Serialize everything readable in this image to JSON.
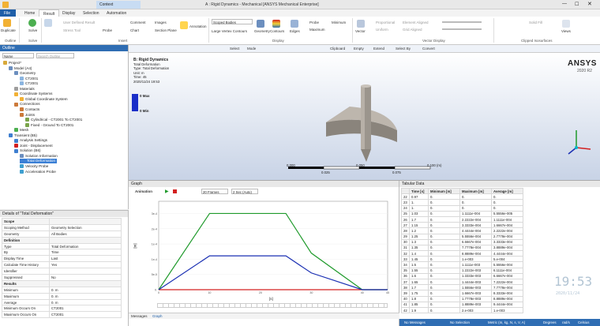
{
  "window": {
    "title": "A : Rigid Dynamics - Mechanical [ANSYS Mechanical Enterprise]",
    "context_tab": "Context"
  },
  "ribbon_tabs": [
    "File",
    "Home",
    "Result",
    "Display",
    "Selection",
    "Automation"
  ],
  "ribbon": {
    "duplicate": "Duplicate",
    "solve": "Solve",
    "solve_icon_label": "Solve",
    "user_defined_result": "User Defined Result",
    "stress_tool": "Stress Tool",
    "probe": "Probe",
    "comment": "Comment",
    "images": "Images",
    "chart": "Chart",
    "section_plane": "Section Plane",
    "annotation": "Annotation",
    "scoped_bodies": "Scoped Bodies",
    "large_vertex_contours": "Large Vertex Contours",
    "geometry": "Geometry",
    "contours": "Contours",
    "edges": "Edges",
    "probe_btn": "Probe",
    "maximum": "Maximum",
    "minimum": "Minimum",
    "vector": "Vector",
    "proportional": "Proportional",
    "uniform": "Uniform",
    "element_aligned": "Element Aligned",
    "grid_aligned": "Grid Aligned",
    "solid_fill": "Solid Fill",
    "views": "Views",
    "groups": [
      "Outline",
      "Solve",
      "Insert",
      "Display",
      "Vector Display",
      "Clipped Isosurfaces"
    ]
  },
  "outline": {
    "title": "Outline",
    "search_label": "Name",
    "search_placeholder": "Search Outline",
    "tree": [
      "Project*",
      "Model (A4)",
      "Geometry",
      "CT2001",
      "CT2001",
      "Materials",
      "Coordinate Systems",
      "Global Coordinate System",
      "Connections",
      "Contacts",
      "Joints",
      "Cylindrical - CT2001 To CT2001",
      "Fixed - Ground To CT2001",
      "Mesh",
      "Transient (B5)",
      "Analysis Settings",
      "Joint - Displacement",
      "Solution (B6)",
      "Solution Information",
      "Total Deformation",
      "Velocity Probe",
      "Acceleration Probe"
    ]
  },
  "details": {
    "title": "Details of \"Total Deformation\"",
    "rows": [
      {
        "k": "Scope",
        "v": "",
        "sec": true
      },
      {
        "k": "Scoping Method",
        "v": "Geometry Selection"
      },
      {
        "k": "Geometry",
        "v": "All Bodies"
      },
      {
        "k": "Definition",
        "v": "",
        "sec": true
      },
      {
        "k": "Type",
        "v": "Total Deformation"
      },
      {
        "k": "By",
        "v": "Time"
      },
      {
        "k": "Display Time",
        "v": "Last"
      },
      {
        "k": "Calculate Time History",
        "v": "Yes"
      },
      {
        "k": "Identifier",
        "v": ""
      },
      {
        "k": "Suppressed",
        "v": "No"
      },
      {
        "k": "Results",
        "v": "",
        "sec": true
      },
      {
        "k": "Minimum",
        "v": "0. m"
      },
      {
        "k": "Maximum",
        "v": "0. m"
      },
      {
        "k": "Average",
        "v": "0. m"
      },
      {
        "k": "Minimum Occurs On",
        "v": "CT2001"
      },
      {
        "k": "Maximum Occurs On",
        "v": "CT2001"
      }
    ]
  },
  "viewport": {
    "toolbar": [
      "Select",
      "Mode",
      "Clipboard",
      "Empty",
      "Extend",
      "Select By",
      "Convert"
    ],
    "legend_title": "B: Rigid Dynamics",
    "legend_lines": [
      "Total Deformation",
      "Type: Total Deformation",
      "Unit: m",
      "Time: 45",
      "2020/11/24 19:53"
    ],
    "max_label": "0 Max",
    "min_label": "0 Min",
    "brand": "ANSYS",
    "version": "2020 R2",
    "scale_labels": [
      "0.000",
      "0.050",
      "0.100 (m)"
    ],
    "scale_sub": [
      "0.025",
      "0.075"
    ]
  },
  "graph": {
    "title": "Graph",
    "animation": "Animation",
    "frames": "20 Frames",
    "speed": "2 Sec (Auto)",
    "ylabel": "[m]",
    "xlabel": "[s]",
    "bottom_tabs": [
      "Messages",
      "Graph"
    ]
  },
  "chart_data": {
    "type": "line",
    "x": [
      0,
      10,
      15,
      25,
      30,
      40,
      45
    ],
    "xlim": [
      0,
      45
    ],
    "ylim": [
      0,
      0.00029
    ],
    "xticks": [
      0,
      10,
      20,
      30,
      40,
      45
    ],
    "yticks": [
      0,
      5e-05,
      0.0001,
      0.00015,
      0.0002,
      0.00025
    ],
    "series": [
      {
        "name": "Minimum",
        "color": "#d32020",
        "values": [
          0,
          0,
          0,
          0,
          0,
          0,
          0
        ]
      },
      {
        "name": "Maximum",
        "color": "#1f9a2b",
        "values": [
          0,
          0.00025,
          0.00025,
          0.00025,
          0.00012,
          0,
          0
        ]
      },
      {
        "name": "Average",
        "color": "#1a2fb3",
        "values": [
          0,
          0.000111,
          0.000111,
          0.000111,
          5.5e-05,
          0,
          0
        ]
      }
    ]
  },
  "tabular": {
    "title": "Tabular Data",
    "headers": [
      "",
      "Time [s]",
      "Minimum [m]",
      "Maximum [m]",
      "Average [m]"
    ],
    "rows": [
      [
        "22",
        "0.97",
        "0.",
        "0.",
        "0."
      ],
      [
        "23",
        "1.",
        "0.",
        "0.",
        "0."
      ],
      [
        "24",
        "1.",
        "0.",
        "0.",
        "0."
      ],
      [
        "25",
        "1.03",
        "0.",
        "1.1111e-004",
        "5.5556e-005"
      ],
      [
        "26",
        "1.7",
        "0.",
        "2.2222e-004",
        "1.1111e-004"
      ],
      [
        "27",
        "1.15",
        "0.",
        "3.3333e-004",
        "1.6667e-004"
      ],
      [
        "28",
        "1.2",
        "0.",
        "4.4444e-004",
        "2.2222e-004"
      ],
      [
        "29",
        "1.25",
        "0.",
        "5.5556e-004",
        "2.7778e-004"
      ],
      [
        "30",
        "1.3",
        "0.",
        "6.6667e-004",
        "3.3333e-004"
      ],
      [
        "31",
        "1.35",
        "0.",
        "7.7778e-004",
        "3.8889e-004"
      ],
      [
        "32",
        "1.4",
        "0.",
        "8.8889e-004",
        "4.4444e-004"
      ],
      [
        "33",
        "1.45",
        "0.",
        "1.e-003",
        "5.e-004"
      ],
      [
        "34",
        "1.5",
        "0.",
        "1.1111e-003",
        "5.5556e-004"
      ],
      [
        "35",
        "1.55",
        "0.",
        "1.2222e-003",
        "6.1111e-004"
      ],
      [
        "36",
        "1.6",
        "0.",
        "1.3333e-003",
        "6.6667e-004"
      ],
      [
        "37",
        "1.65",
        "0.",
        "1.4444e-003",
        "7.2222e-004"
      ],
      [
        "38",
        "1.7",
        "0.",
        "1.5556e-003",
        "7.7778e-004"
      ],
      [
        "39",
        "1.75",
        "0.",
        "1.6667e-003",
        "8.3333e-004"
      ],
      [
        "40",
        "1.8",
        "0.",
        "1.7778e-003",
        "8.8889e-004"
      ],
      [
        "41",
        "1.85",
        "0.",
        "1.8889e-003",
        "9.4444e-004"
      ],
      [
        "42",
        "1.9",
        "0.",
        "2.e-003",
        "1.e-003"
      ]
    ]
  },
  "status": [
    "No Messages",
    "No Selection",
    "Metric (m, kg, N, s, V, A)",
    "Degrees",
    "rad/s",
    "Celsius"
  ],
  "clock": {
    "time": "19:53",
    "date": "2020/11/24"
  }
}
